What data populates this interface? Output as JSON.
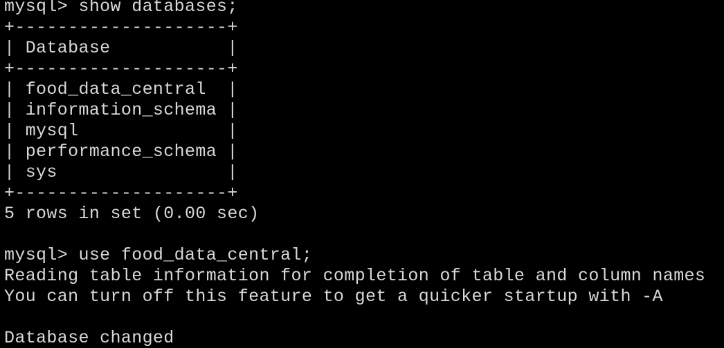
{
  "terminal": {
    "colors": {
      "background": "#000000",
      "foreground": "#d8d8d8"
    },
    "lines": [
      "mysql> show databases;",
      "+--------------------+",
      "| Database           |",
      "+--------------------+",
      "| food_data_central  |",
      "| information_schema |",
      "| mysql              |",
      "| performance_schema |",
      "| sys                |",
      "+--------------------+",
      "5 rows in set (0.00 sec)",
      "",
      "mysql> use food_data_central;",
      "Reading table information for completion of table and column names",
      "You can turn off this feature to get a quicker startup with -A",
      "",
      "Database changed"
    ]
  }
}
